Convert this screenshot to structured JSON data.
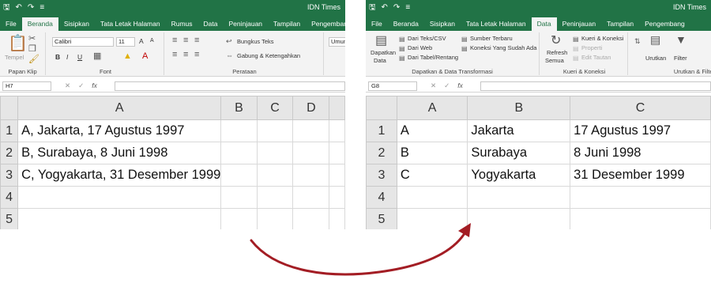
{
  "left": {
    "doc_title": "IDN Times",
    "tabs": [
      "File",
      "Beranda",
      "Sisipkan",
      "Tata Letak Halaman",
      "Rumus",
      "Data",
      "Peninjauan",
      "Tampilan",
      "Pengembang"
    ],
    "active_tab": "Beranda",
    "clipboard": {
      "paste_label": "Tempel",
      "group_label": "Papan Klip"
    },
    "font": {
      "font_name": "Calibri",
      "font_size": "11",
      "bold": "B",
      "italic": "I",
      "underline": "U",
      "grow": "A",
      "shrink": "A",
      "group_label": "Font"
    },
    "alignment": {
      "wrap_label": "Bungkus Teks",
      "merge_label": "Gabung & Ketengahkan",
      "group_label": "Perataan"
    },
    "number": {
      "format_label": "Umum"
    },
    "name_box": "H7",
    "columns": [
      "A",
      "B",
      "C",
      "D"
    ],
    "rows": [
      {
        "num": "1",
        "cells": [
          "A, Jakarta, 17 Agustus 1997"
        ]
      },
      {
        "num": "2",
        "cells": [
          "B, Surabaya, 8 Juni 1998"
        ]
      },
      {
        "num": "3",
        "cells": [
          "C, Yogyakarta, 31 Desember 1999"
        ]
      },
      {
        "num": "4",
        "cells": []
      },
      {
        "num": "5",
        "cells": []
      }
    ]
  },
  "right": {
    "doc_title": "IDN Times",
    "tabs": [
      "File",
      "Beranda",
      "Sisipkan",
      "Tata Letak Halaman",
      "Data",
      "Peninjauan",
      "Tampilan",
      "Pengembang"
    ],
    "active_tab": "Data",
    "get_data": {
      "label_line1": "Dapatkan",
      "label_line2": "Data",
      "from_csv": "Dari Teks/CSV",
      "from_web": "Dari Web",
      "from_table": "Dari Tabel/Rentang",
      "recent": "Sumber Terbaru",
      "existing": "Koneksi Yang Sudah Ada",
      "group_label": "Dapatkan & Data Transformasi"
    },
    "queries": {
      "refresh_line1": "Refresh",
      "refresh_line2": "Semua",
      "queries_conn": "Kueri & Koneksi",
      "properties": "Properti",
      "edit_links": "Edit Tautan",
      "group_label": "Kueri & Koneksi"
    },
    "sort": {
      "sort_label": "Urutkan",
      "filter_label": "Filter",
      "group_label": "Urutkan & Filter"
    },
    "name_box": "G8",
    "columns": [
      "A",
      "B",
      "C"
    ],
    "rows": [
      {
        "num": "1",
        "cells": [
          "A",
          "Jakarta",
          "17 Agustus 1997"
        ]
      },
      {
        "num": "2",
        "cells": [
          "B",
          "Surabaya",
          "8 Juni 1998"
        ]
      },
      {
        "num": "3",
        "cells": [
          "C",
          "Yogyakarta",
          "31 Desember 1999"
        ]
      },
      {
        "num": "4",
        "cells": [
          "",
          "",
          ""
        ]
      },
      {
        "num": "5",
        "cells": [
          "",
          "",
          ""
        ]
      }
    ]
  },
  "colors": {
    "excel_green": "#217346",
    "arrow": "#a31d24"
  },
  "icons": [
    "save-icon",
    "undo-icon",
    "redo-icon",
    "cut-icon",
    "copy-icon",
    "format-painter-icon",
    "fill-color-icon",
    "font-color-icon",
    "filter-icon",
    "sort-icon",
    "refresh-icon"
  ]
}
